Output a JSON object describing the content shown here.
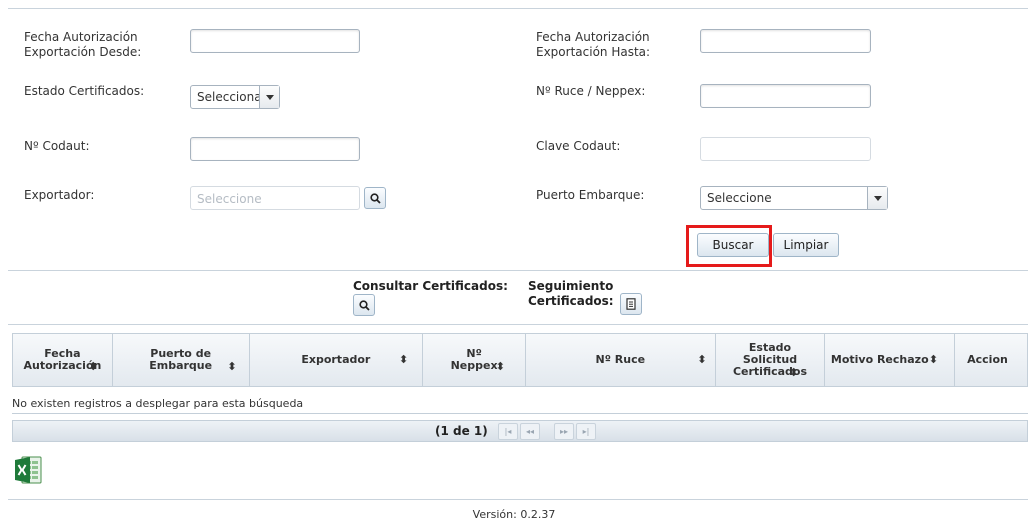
{
  "form": {
    "fecha_desde_label_1": "Fecha Autorización",
    "fecha_desde_label_2": "Exportación Desde:",
    "fecha_hasta_label_1": "Fecha Autorización",
    "fecha_hasta_label_2": "Exportación Hasta:",
    "estado_label": "Estado Certificados:",
    "estado_value": "Seleccionar",
    "ruce_label": "Nº Ruce / Neppex:",
    "codaut_label": "Nº Codaut:",
    "clave_label": "Clave Codaut:",
    "exportador_label": "Exportador:",
    "exportador_placeholder": "Seleccione",
    "puerto_label": "Puerto Embarque:",
    "puerto_value": "Seleccione",
    "buscar": "Buscar",
    "limpiar": "Limpiar"
  },
  "actions": {
    "consultar_label": "Consultar Certificados:",
    "seguimiento_label_1": "Seguimiento",
    "seguimiento_label_2": "Certificados:"
  },
  "table": {
    "headers": [
      {
        "l1": "Fecha",
        "l2": "Autorización",
        "l3": ""
      },
      {
        "l1": "Puerto de",
        "l2": "Embarque",
        "l3": ""
      },
      {
        "l1": "Exportador",
        "l2": "",
        "l3": ""
      },
      {
        "l1": "Nº",
        "l2": "Neppex",
        "l3": ""
      },
      {
        "l1": "Nº Ruce",
        "l2": "",
        "l3": ""
      },
      {
        "l1": "Estado",
        "l2": "Solicitud",
        "l3": "Certificados"
      },
      {
        "l1": "Motivo Rechazo",
        "l2": "",
        "l3": ""
      },
      {
        "l1": "Accion",
        "l2": "",
        "l3": ""
      }
    ],
    "empty_message": "No existen registros a desplegar para esta búsqueda",
    "paginator": "(1 de 1)",
    "sort_glyph": "⬍"
  },
  "footer": {
    "version": "Versión: 0.2.37"
  }
}
